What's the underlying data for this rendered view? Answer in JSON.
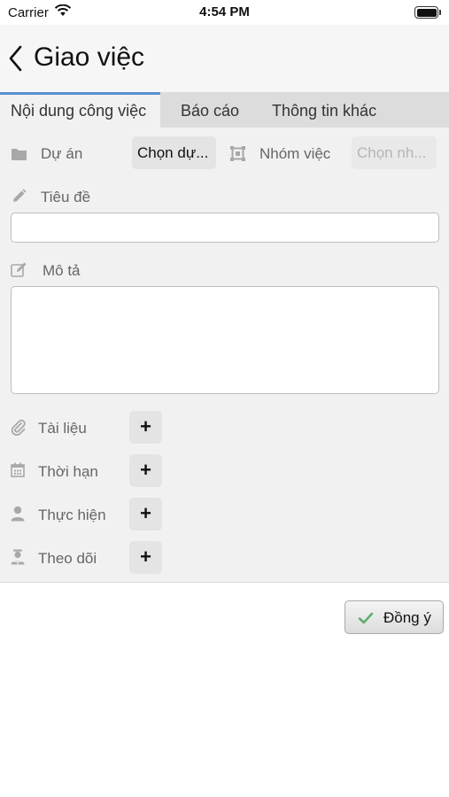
{
  "status_bar": {
    "carrier": "Carrier",
    "time": "4:54 PM"
  },
  "nav": {
    "title": "Giao việc"
  },
  "tabs": [
    {
      "label": "Nội dung công việc",
      "active": true
    },
    {
      "label": "Báo cáo",
      "active": false
    },
    {
      "label": "Thông tin khác",
      "active": false
    }
  ],
  "form": {
    "project": {
      "label": "Dự án",
      "button": "Chọn dự..."
    },
    "work_group": {
      "label": "Nhóm việc",
      "button": "Chọn nh..."
    },
    "title": {
      "label": "Tiêu đề",
      "value": ""
    },
    "description": {
      "label": "Mô tả",
      "value": ""
    },
    "attachments": {
      "label": "Tài liệu",
      "button": "+"
    },
    "deadline": {
      "label": "Thời hạn",
      "button": "+"
    },
    "assignee": {
      "label": "Thực hiện",
      "button": "+"
    },
    "follower": {
      "label": "Theo dõi",
      "button": "+"
    }
  },
  "footer": {
    "confirm_label": "Đồng ý"
  },
  "colors": {
    "tab_accent": "#5b8fd0",
    "confirm_check": "#5fae6e",
    "icon_gray": "#a8a8a8"
  },
  "icons": [
    "wifi-icon",
    "battery-icon",
    "back-chevron-icon",
    "folder-icon",
    "group-icon",
    "pencil-icon",
    "edit-icon",
    "paperclip-icon",
    "calendar-icon",
    "person-icon",
    "follower-icon",
    "check-icon"
  ]
}
